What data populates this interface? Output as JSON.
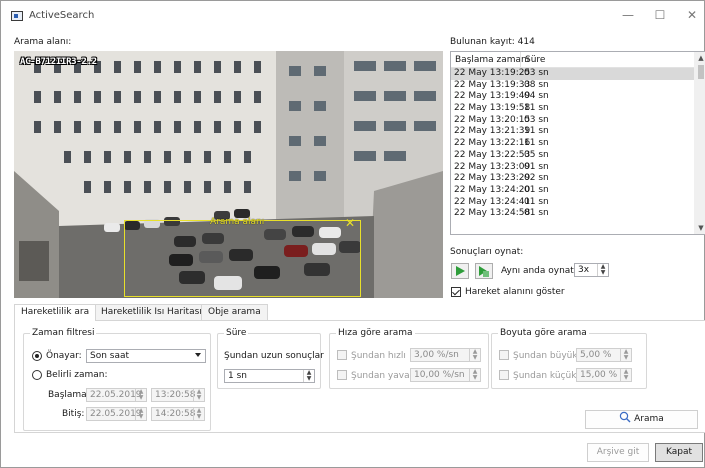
{
  "window": {
    "title": "ActiveSearch",
    "minimize": "—",
    "maximize": "☐",
    "close": "✕"
  },
  "search_area": {
    "label": "Arama alanı:",
    "camera_label": "AC-B712IIR3-2.2",
    "area_caption": "Arama alanı",
    "area_close": "✕"
  },
  "results": {
    "count_label": "Bulunan kayıt: 414",
    "columns": [
      "Başlama zamanı",
      "Süre"
    ],
    "rows": [
      {
        "start": "22 May 13:19:25",
        "duration": "03 sn"
      },
      {
        "start": "22 May 13:19:33",
        "duration": "08 sn"
      },
      {
        "start": "22 May 13:19:49",
        "duration": "04 sn"
      },
      {
        "start": "22 May 13:19:58",
        "duration": "11 sn"
      },
      {
        "start": "22 May 13:20:15",
        "duration": "03 sn"
      },
      {
        "start": "22 May 13:21:39",
        "duration": "11 sn"
      },
      {
        "start": "22 May 13:22:16",
        "duration": "11 sn"
      },
      {
        "start": "22 May 13:22:53",
        "duration": "05 sn"
      },
      {
        "start": "22 May 13:23:09",
        "duration": "01 sn"
      },
      {
        "start": "22 May 13:23:29",
        "duration": "02 sn"
      },
      {
        "start": "22 May 13:24:20",
        "duration": "01 sn"
      },
      {
        "start": "22 May 13:24:41",
        "duration": "01 sn"
      },
      {
        "start": "22 May 13:24:58",
        "duration": "01 sn"
      }
    ],
    "selected_index": 0
  },
  "playback": {
    "label": "Sonuçları oynat:",
    "simultaneous_label": "Aynı anda oynat:",
    "simultaneous_value": "3x",
    "show_motion_area": "Hareket alanını göster",
    "show_motion_area_checked": true
  },
  "tabs": [
    {
      "label": "Hareketlilik ara",
      "active": true
    },
    {
      "label": "Hareketlilik Isı Haritası",
      "active": false
    },
    {
      "label": "Obje arama",
      "active": false
    }
  ],
  "time_filter": {
    "title": "Zaman filtresi",
    "preset_label": "Önayar:",
    "preset_value": "Son saat",
    "custom_label": "Belirli zaman:",
    "start_label": "Başlama:",
    "start_date": "22.05.2019",
    "start_time": "13:20:58",
    "end_label": "Bitiş:",
    "end_date": "22.05.2019",
    "end_time": "14:20:58",
    "preset_selected": true
  },
  "duration": {
    "title": "Süre",
    "longer_than_label": "Şundan uzun sonuçlar",
    "longer_than_value": "1 sn"
  },
  "speed": {
    "title": "Hıza göre arama",
    "faster_label": "Şundan hızlı",
    "faster_value": "3,00 %/sn",
    "slower_label": "Şundan yavaş",
    "slower_value": "10,00 %/sn"
  },
  "size": {
    "title": "Boyuta göre arama",
    "larger_label": "Şundan büyük",
    "larger_value": "5,00 %",
    "smaller_label": "Şundan küçük",
    "smaller_value": "15,00 %"
  },
  "buttons": {
    "search": "Arama",
    "archive": "Arşive git",
    "close": "Kapat"
  },
  "colors": {
    "area_outline": "#e8e02a",
    "play_green": "#2e9d3a",
    "selected_row": "#d9d9d9"
  }
}
